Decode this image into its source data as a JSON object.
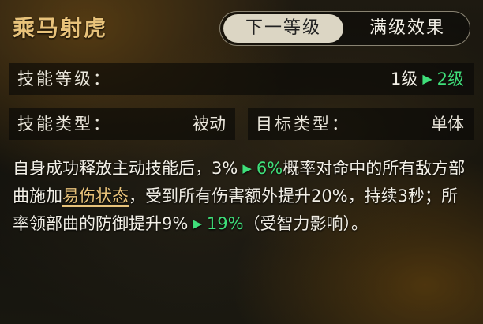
{
  "skill": {
    "name": "乘马射虎"
  },
  "tabs": {
    "next_level": "下一等级",
    "max_level": "满级效果"
  },
  "level": {
    "label": "技能等级：",
    "from": "1级",
    "to": "2级",
    "arrow_icon": "right-triangle"
  },
  "skill_type": {
    "label": "技能类型：",
    "value": "被动"
  },
  "target_type": {
    "label": "目标类型：",
    "value": "单体"
  },
  "description": {
    "p1": "自身成功释放主动技能后，",
    "rate_from": "3%",
    "rate_to": "6%",
    "p2": "概率对命中的所有敌方部曲施加",
    "status": "易伤状态",
    "p3": "，受到所有伤害额外提升20%，持续3秒；所率领部曲的防御提升",
    "def_from": "9%",
    "def_to": "19%",
    "p4": "（受智力影响）。"
  },
  "colors": {
    "title": "#e8c27a",
    "green": "#3fdf7a",
    "text": "#f2efe6"
  }
}
